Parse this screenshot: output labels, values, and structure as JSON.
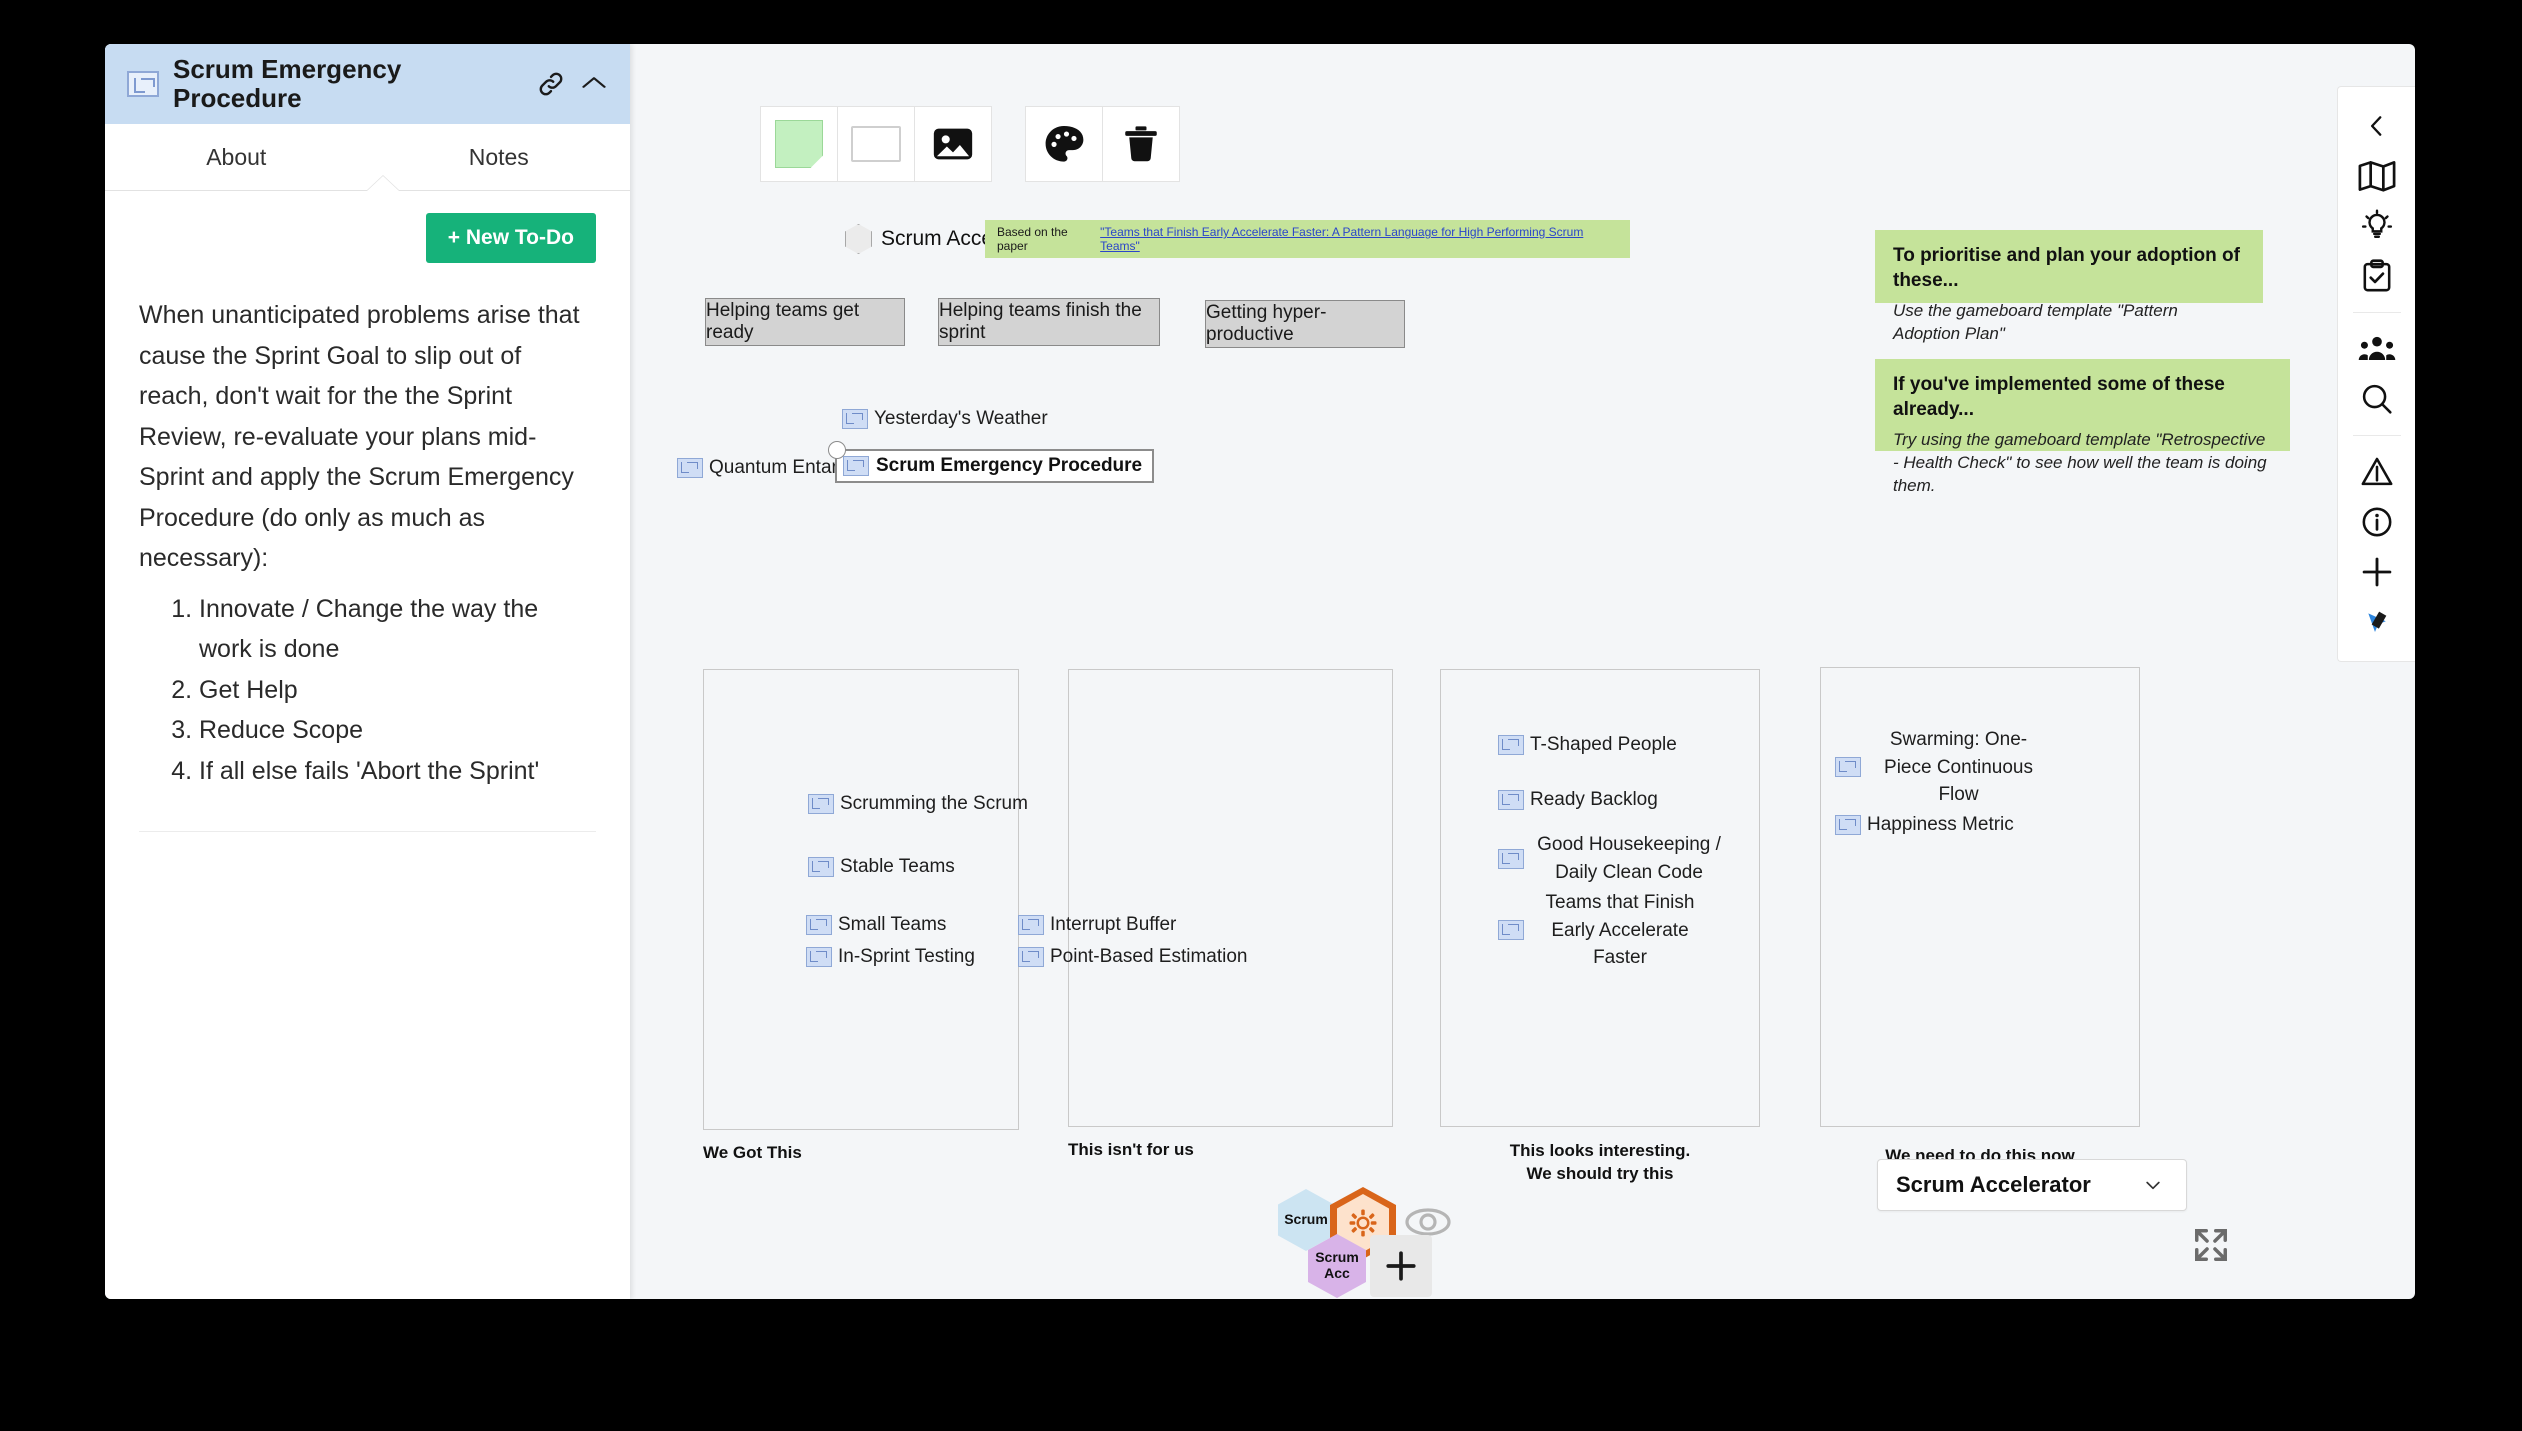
{
  "panel": {
    "title": "Scrum Emergency Procedure",
    "icon": "pattern-icon",
    "link_icon": "link-icon",
    "collapse_icon": "chevron-up-icon",
    "tabs": [
      {
        "label": "About",
        "active": true
      },
      {
        "label": "Notes",
        "active": false
      }
    ],
    "new_todo_label": "+ New To-Do",
    "new_todo_color": "#16b27a",
    "paragraph": "When unanticipated problems arise that cause the Sprint Goal to slip out of reach, don't wait for the the Sprint Review, re-evaluate your plans mid-Sprint and apply the Scrum Emergency Procedure (do only as much as necessary):",
    "steps": [
      "Innovate / Change the way the work is done",
      "Get Help",
      "Reduce Scope",
      "If all else fails 'Abort the Sprint'"
    ]
  },
  "toolbar": {
    "buttons": [
      {
        "name": "add-sticky-note-button",
        "icon": "sticky-note-icon"
      },
      {
        "name": "add-rectangle-button",
        "icon": "rectangle-icon"
      },
      {
        "name": "add-image-button",
        "icon": "image-icon"
      },
      {
        "name": "palette-button",
        "icon": "palette-icon"
      },
      {
        "name": "delete-button",
        "icon": "trash-icon"
      }
    ]
  },
  "canvas": {
    "accelerator_node": {
      "label": "Scrum Accelerator",
      "icon": "hexagon-icon"
    },
    "paper_note": {
      "prefix": "Based on the paper ",
      "link": "\"Teams that Finish Early Accelerate Faster: A Pattern Language for High Performing Scrum Teams\"",
      "bg": "#c5e39a"
    },
    "category_buttons": [
      {
        "label": "Helping teams get ready"
      },
      {
        "label": "Helping teams finish the sprint"
      },
      {
        "label": "Getting hyper-productive"
      }
    ],
    "loose_nodes": [
      {
        "label": "Yesterday's Weather",
        "icon": "pattern-icon"
      },
      {
        "label": "Quantum Entanglement",
        "icon": "pattern-icon"
      }
    ],
    "selected_node": {
      "label": "Scrum Emergency Procedure",
      "icon": "pattern-icon"
    },
    "green_notes": [
      {
        "title": "To prioritise and plan your adoption of these...",
        "subtitle": "Use the gameboard template \"Pattern Adoption Plan\""
      },
      {
        "title": "If you've implemented some of these already...",
        "subtitle": "Try using the gameboard template \"Retrospective - Health Check\" to see how well the team is doing them."
      }
    ],
    "columns": [
      {
        "caption": "We Got This",
        "items": [
          {
            "label": "Scrumming the Scrum",
            "icon": "pattern-icon"
          },
          {
            "label": "Stable Teams",
            "icon": "pattern-icon"
          },
          {
            "label": "Small Teams",
            "icon": "pattern-icon"
          },
          {
            "label": "In-Sprint Testing",
            "icon": "pattern-icon"
          }
        ]
      },
      {
        "caption": "This isn't for us",
        "items": [
          {
            "label": "Interrupt Buffer",
            "icon": "pattern-icon"
          },
          {
            "label": "Point-Based Estimation",
            "icon": "pattern-icon"
          }
        ]
      },
      {
        "caption": "This looks interesting.\nWe should try this",
        "items": [
          {
            "label": "T-Shaped People",
            "icon": "pattern-icon"
          },
          {
            "label": "Ready Backlog",
            "icon": "pattern-icon"
          },
          {
            "label": "Good Housekeeping / Daily Clean Code",
            "icon": "pattern-icon"
          },
          {
            "label": "Teams that Finish Early Accelerate Faster",
            "icon": "pattern-icon"
          }
        ]
      },
      {
        "caption": "We need to do this now",
        "items": [
          {
            "label": "Swarming: One-Piece Continuous Flow",
            "icon": "pattern-icon"
          },
          {
            "label": "Happiness Metric",
            "icon": "pattern-icon"
          }
        ]
      }
    ]
  },
  "rail": {
    "items": [
      {
        "name": "collapse-rail-button",
        "icon": "chevron-left-icon"
      },
      {
        "name": "map-button",
        "icon": "map-icon"
      },
      {
        "name": "ideas-button",
        "icon": "lightbulb-icon"
      },
      {
        "name": "tasks-button",
        "icon": "clipboard-check-icon"
      },
      {
        "name": "people-button",
        "icon": "people-icon"
      },
      {
        "name": "search-button",
        "icon": "search-icon"
      },
      {
        "name": "alerts-button",
        "icon": "warning-triangle-icon"
      },
      {
        "name": "info-button",
        "icon": "info-circle-icon"
      },
      {
        "name": "add-button",
        "icon": "plus-icon"
      },
      {
        "name": "pointer-tool-button",
        "icon": "cursor-tool-icon"
      }
    ]
  },
  "hex_cluster": [
    {
      "name": "hex-scrum",
      "label": "Scrum",
      "fill": "#cce4f2",
      "stroke": "#8fb8cf"
    },
    {
      "name": "hex-gear",
      "label": "",
      "fill": "#fde2cc",
      "stroke": "#d9651a",
      "icon": "gear-icon"
    },
    {
      "name": "hex-eye",
      "label": "",
      "fill": "#efefef",
      "stroke": "#bdbdbd",
      "icon": "eye-icon"
    },
    {
      "name": "hex-scrum-acc",
      "label": "Scrum Acc",
      "fill": "#d8b3e8",
      "stroke": "#a770c2"
    },
    {
      "name": "hex-add",
      "label": "",
      "fill": "#e8e8e8",
      "stroke": "#e8e8e8",
      "icon": "plus-icon"
    }
  ],
  "board_select": {
    "value": "Scrum Accelerator",
    "icon": "chevron-down-icon"
  },
  "fullscreen": {
    "icon": "fullscreen-icon"
  }
}
